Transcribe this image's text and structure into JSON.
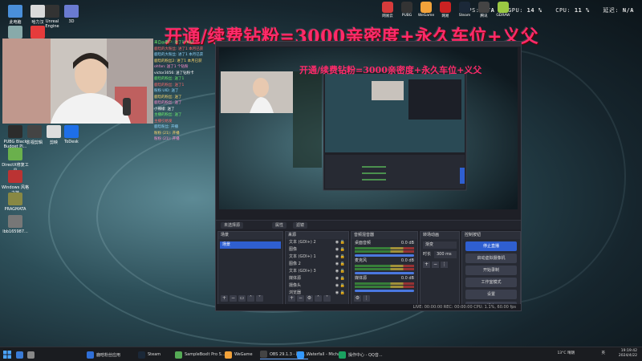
{
  "overlay": {
    "fps_label": "FPS:",
    "fps_value": "N/A",
    "gpu_label": "GPU:",
    "gpu_value": "14 %",
    "cpu_label": "CPU:",
    "cpu_value": "11 %",
    "latency_label": "延迟:",
    "latency_value": "N/A"
  },
  "banner_text": "开通/续费钻粉=3000亲密度+永久车位+义父",
  "desktop_icons": [
    {
      "label": "此电脑",
      "color": "#4a8fd9"
    },
    {
      "label": "哈力汉",
      "color": "#d9d9d9"
    },
    {
      "label": "Unreal Engine",
      "color": "#333"
    },
    {
      "label": "3D",
      "color": "#6a7bd1"
    },
    {
      "label": "回收站",
      "color": "#8aa"
    },
    {
      "label": "有道",
      "color": "#e63b3b"
    },
    {
      "label": "英雄联盟",
      "color": "#bfa05a"
    },
    {
      "label": "PUBG Black Budget Pl...",
      "color": "#2c2c2c"
    },
    {
      "label": "DirectX修复工具",
      "color": "#6ab04c"
    },
    {
      "label": "Windows 风格之技",
      "color": "#b33"
    },
    {
      "label": "PRAGMATA",
      "color": "#884"
    },
    {
      "label": "lbb165987...",
      "color": "#777"
    },
    {
      "label": "影视剪辑",
      "color": "#444"
    },
    {
      "label": "剪映",
      "color": "#ddd"
    },
    {
      "label": "ToDesk",
      "color": "#1e6fe8"
    }
  ],
  "top_apps": [
    {
      "label": "网易云",
      "color": "#d63b3b"
    },
    {
      "label": "PUBG",
      "color": "#333"
    },
    {
      "label": "WeGame",
      "color": "#f2a23a"
    },
    {
      "label": "网易",
      "color": "#cc2222"
    },
    {
      "label": "Steam",
      "color": "#1b2838"
    },
    {
      "label": "腾讯",
      "color": "#444"
    },
    {
      "label": "GDRAW",
      "color": "#9ac943"
    }
  ],
  "chat_lines": [
    "来自@用户: 进了1 (Kdj)",
    "鹿晗的大粉丝: 进了1 本月已获",
    "鹿晗的大粉丝: 进了1 本月已获",
    "鹿晗的粉丝2: 进了1 本月已获",
    "ohfan: 送了1 个钻粉",
    "victor3056: 送了钻粉卡",
    "鹿晗的粉丝: 送了1",
    "鹿晗的粉丝: 送了1",
    "粉粉 UID: 送了",
    "鹿晗的粉丝: 送了",
    "鹿晗的粉丝: 送了",
    "小辣椒: 送了",
    "主播的粉丝: 送了",
    "主播引始发",
    "鹿晗粉丝: 开播",
    "粉粉 (21): 开播",
    "粉粉 (21): 开播"
  ],
  "obs": {
    "window_title": "OBS 29.1.3 - 配置文件: 未命名 - 场景: 未命名",
    "preview_banner": "开通/续费钻粉=3000亲密度+永久车位+义父",
    "toolbar": {
      "scene_btn": "未选择源",
      "props_btn": "属性",
      "filter_btn": "滤镜"
    },
    "docks": {
      "scenes": {
        "title": "场景",
        "items": [
          "场景"
        ]
      },
      "sources": {
        "title": "来源",
        "items": [
          "文本 (GDI+) 2",
          "图像",
          "文本 (GDI+) 1",
          "图像 2",
          "文本 (GDI+) 3",
          "媒体源",
          "摄像头",
          "浏览器"
        ]
      },
      "mixer": {
        "title": "音频混音器",
        "channels": [
          {
            "name": "桌面音频",
            "db": "0.0 dB"
          },
          {
            "name": "麦克风",
            "db": "0.0 dB"
          },
          {
            "name": "媒体源",
            "db": "0.0 dB"
          }
        ]
      },
      "transitions": {
        "title": "转场动画",
        "type": "渐变",
        "duration_label": "时长",
        "duration_value": "300 ms"
      },
      "controls": {
        "title": "控制按钮",
        "buttons": [
          "停止直播",
          "启动虚拟摄像机",
          "开始录制",
          "工作室模式",
          "设置",
          "退出"
        ]
      }
    },
    "status": "LIVE: 00:00:00  REC: 00:00:00  CPU: 1.1%, 60.00 fps"
  },
  "taskbar": {
    "items": [
      {
        "label": "",
        "color": "#3a7bd5"
      },
      {
        "label": "",
        "color": "#888"
      },
      {
        "label": "鹿晗粉丝应用",
        "color": "#2f6fd8"
      },
      {
        "label": "Steam",
        "color": "#1b2838"
      },
      {
        "label": "SampleBoxIt Pro S...",
        "color": "#5a5"
      },
      {
        "label": "WeGame",
        "color": "#f2a23a"
      },
      {
        "label": "OBS 29.1.3 - 配置...",
        "color": "#444"
      },
      {
        "label": "Waterfall - Micha...",
        "color": "#39f"
      },
      {
        "label": "操作中心 - QQ音...",
        "color": "#1aa260"
      }
    ],
    "weather": "13°C 晴朗",
    "time": "19:19:42",
    "date": "2024/4/22",
    "ime": "英"
  }
}
